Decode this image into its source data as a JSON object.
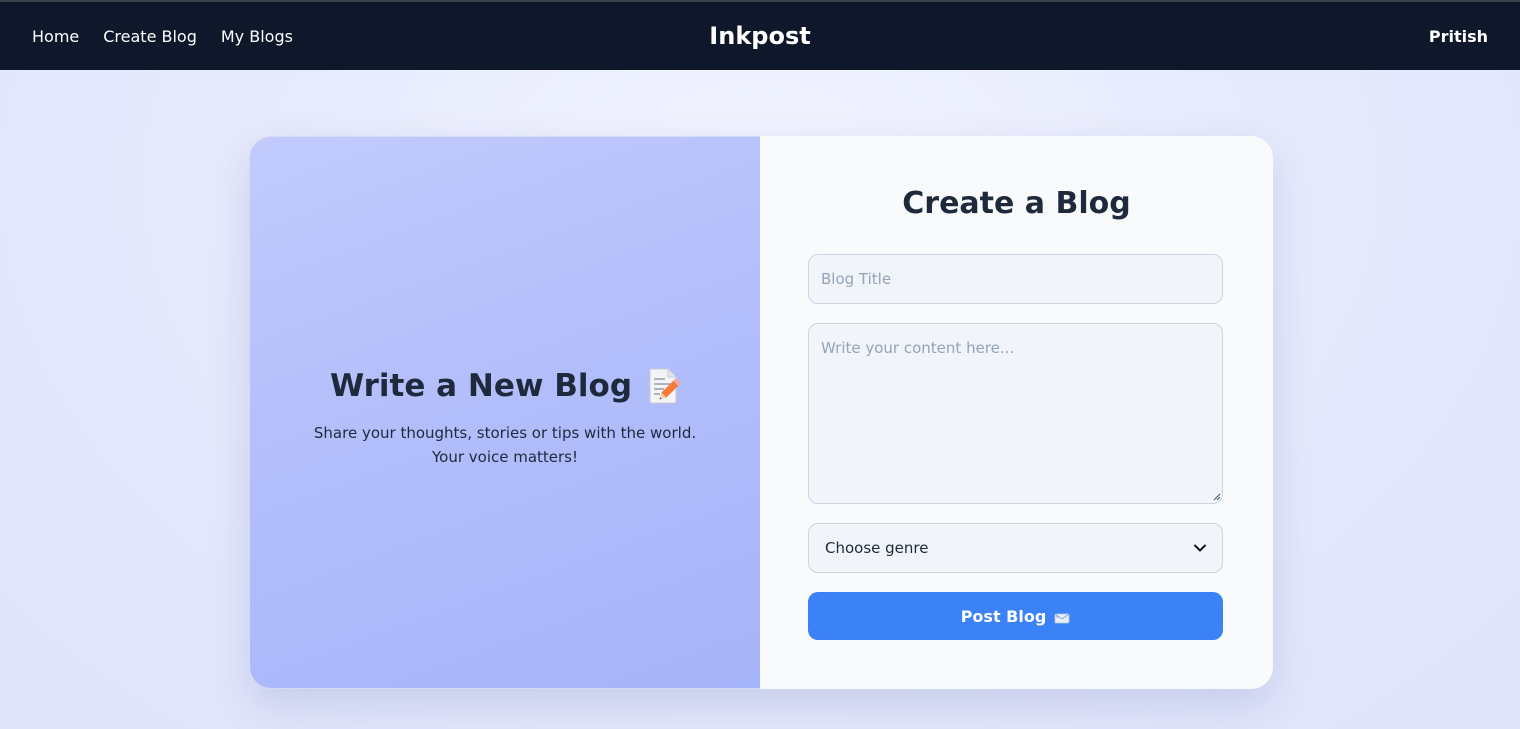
{
  "nav": {
    "links": [
      {
        "label": "Home"
      },
      {
        "label": "Create Blog"
      },
      {
        "label": "My Blogs"
      }
    ],
    "brand": "Inkpost",
    "user": "Pritish"
  },
  "hero": {
    "title": "Write a New Blog",
    "icon": "memo-icon",
    "description": "Share your thoughts, stories or tips with the world. Your voice matters!"
  },
  "form": {
    "title": "Create a Blog",
    "title_placeholder": "Blog Title",
    "title_value": "",
    "content_placeholder": "Write your content here...",
    "content_value": "",
    "genre_selected": "Choose genre",
    "submit_label": "Post Blog",
    "submit_icon": "envelope-icon"
  },
  "colors": {
    "navbar": "#0f172a",
    "accent": "#3b82f6",
    "panel_gradient_start": "#c2cbfc",
    "panel_gradient_end": "#a6b4f9"
  }
}
